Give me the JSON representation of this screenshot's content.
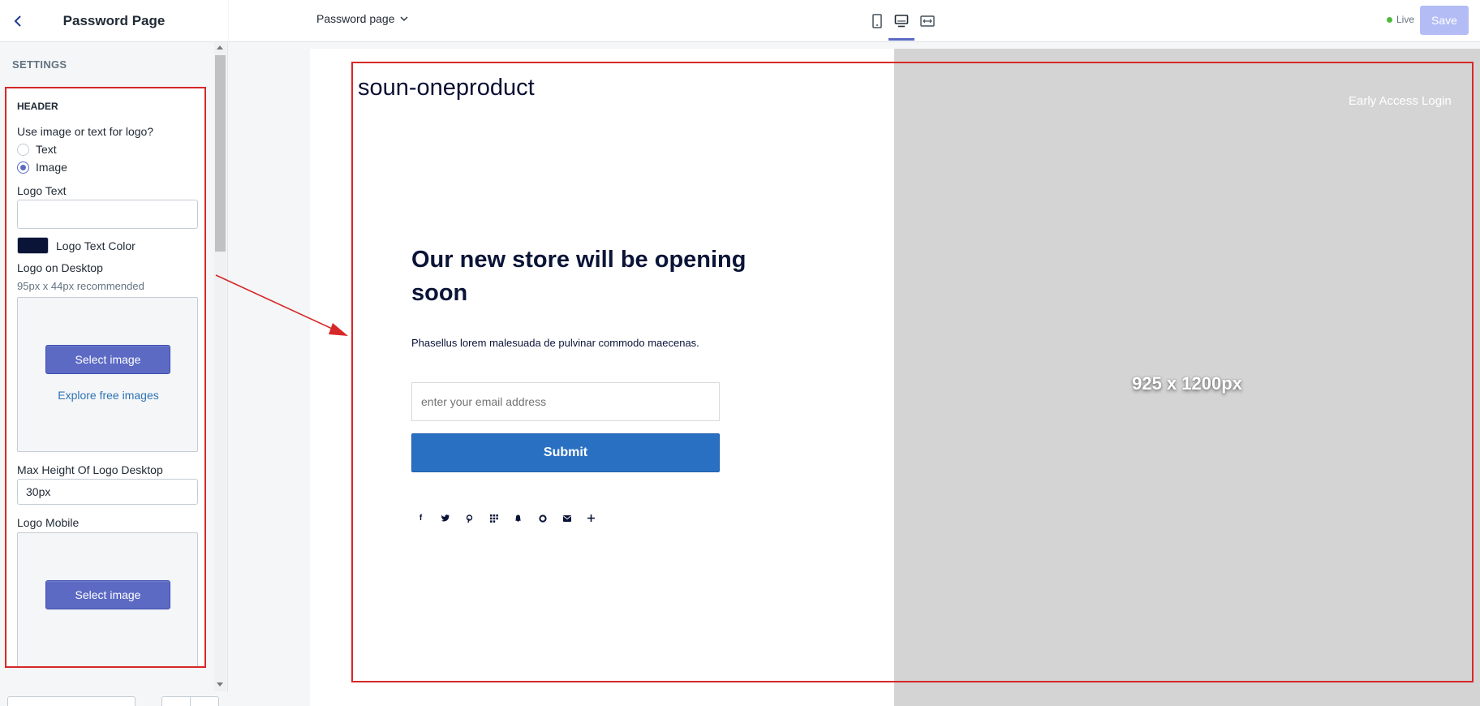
{
  "sidebar": {
    "title": "Password Page",
    "settings_label": "SETTINGS",
    "header_section": {
      "title": "HEADER",
      "logo_choice_label": "Use image or text for logo?",
      "options": [
        {
          "label": "Text",
          "checked": false
        },
        {
          "label": "Image",
          "checked": true
        }
      ],
      "logo_text_label": "Logo Text",
      "logo_text_value": "",
      "logo_text_color_label": "Logo Text Color",
      "logo_text_color": "#0a1437",
      "logo_desktop_label": "Logo on Desktop",
      "logo_desktop_hint": "95px x 44px recommended",
      "select_image_label": "Select image",
      "explore_label": "Explore free images",
      "max_height_label": "Max Height Of Logo Desktop",
      "max_height_value": "30px",
      "logo_mobile_label": "Logo Mobile",
      "select_image_mobile_label": "Select image"
    }
  },
  "topbar": {
    "page_select": "Password page",
    "devices": [
      "mobile-icon",
      "desktop-icon",
      "fullscreen-icon"
    ],
    "active_device": "desktop-icon",
    "status": "Live",
    "save_label": "Save"
  },
  "preview": {
    "store_name": "soun-oneproduct",
    "early_access": "Early Access Login",
    "headline": "Our new store will be opening soon",
    "subtext": "Phasellus lorem malesuada de pulvinar commodo maecenas.",
    "email_placeholder": "enter your email address",
    "submit_label": "Submit",
    "social_icons": [
      "facebook-icon",
      "twitter-icon",
      "pinterest-icon",
      "grid-icon",
      "snapchat-icon",
      "circle-icon",
      "email-icon",
      "plus-icon"
    ],
    "image_placeholder": "925 x 1200px"
  },
  "colors": {
    "accent": "#5c6ac4",
    "submit": "#2a70c2",
    "annotation": "#d62828",
    "live": "#50b83c"
  }
}
